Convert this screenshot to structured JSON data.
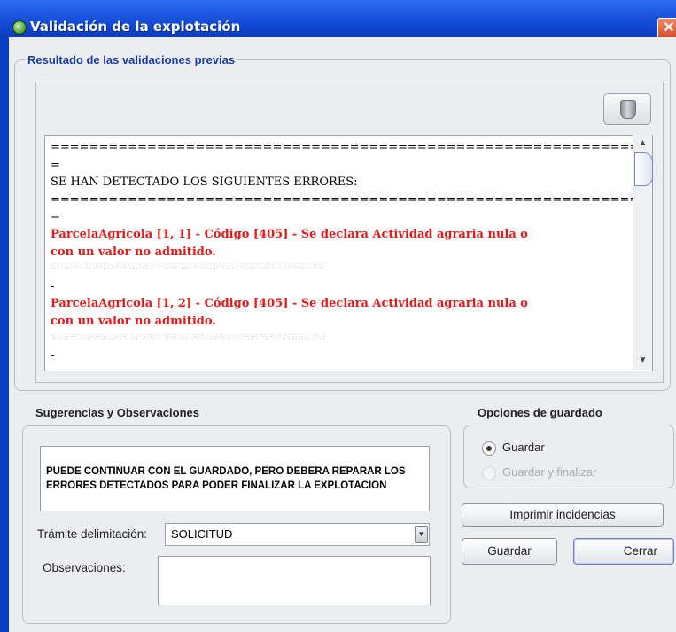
{
  "window": {
    "title": "Validación de la explotación",
    "close_glyph": "✕"
  },
  "results_group": {
    "label": "Resultado de las validaciones previas",
    "log_lines": [
      {
        "text": "======================================================================",
        "style": "norm"
      },
      {
        "text": "=",
        "style": "norm"
      },
      {
        "text": "SE HAN DETECTADO LOS SIGUIENTES ERRORES:",
        "style": "norm"
      },
      {
        "text": "======================================================================",
        "style": "norm"
      },
      {
        "text": "=",
        "style": "norm"
      },
      {
        "text": "ParcelaAgricola [1, 1] - Código [405] - Se declara Actividad agraria nula o",
        "style": "err"
      },
      {
        "text": "con un valor no admitido.",
        "style": "err"
      },
      {
        "text": "----------------------------------------------------------------------",
        "style": "norm"
      },
      {
        "text": "-",
        "style": "norm"
      },
      {
        "text": "ParcelaAgricola [1, 2] - Código [405] - Se declara Actividad agraria nula o",
        "style": "err"
      },
      {
        "text": "con un valor no admitido.",
        "style": "err"
      },
      {
        "text": "----------------------------------------------------------------------",
        "style": "norm"
      },
      {
        "text": "-",
        "style": "norm"
      }
    ],
    "scroll_up": "▲",
    "scroll_down": "▼"
  },
  "suggestions_group": {
    "label": "Sugerencias y Observaciones",
    "message": "PUEDE CONTINUAR CON EL GUARDADO, PERO DEBERA REPARAR LOS ERRORES DETECTADOS PARA PODER FINALIZAR LA EXPLOTACION",
    "tramite_label": "Trámite delimitación:",
    "tramite_value": "SOLICITUD",
    "dropdown_arrow": "▼",
    "observaciones_label": "Observaciones:",
    "observaciones_value": ""
  },
  "save_options": {
    "label": "Opciones de guardado",
    "options": [
      {
        "label": "Guardar",
        "selected": true,
        "enabled": true
      },
      {
        "label": "Guardar y finalizar",
        "selected": false,
        "enabled": false
      }
    ]
  },
  "buttons": {
    "print": "Imprimir incidencias",
    "save": "Guardar",
    "close": "Cerrar"
  }
}
